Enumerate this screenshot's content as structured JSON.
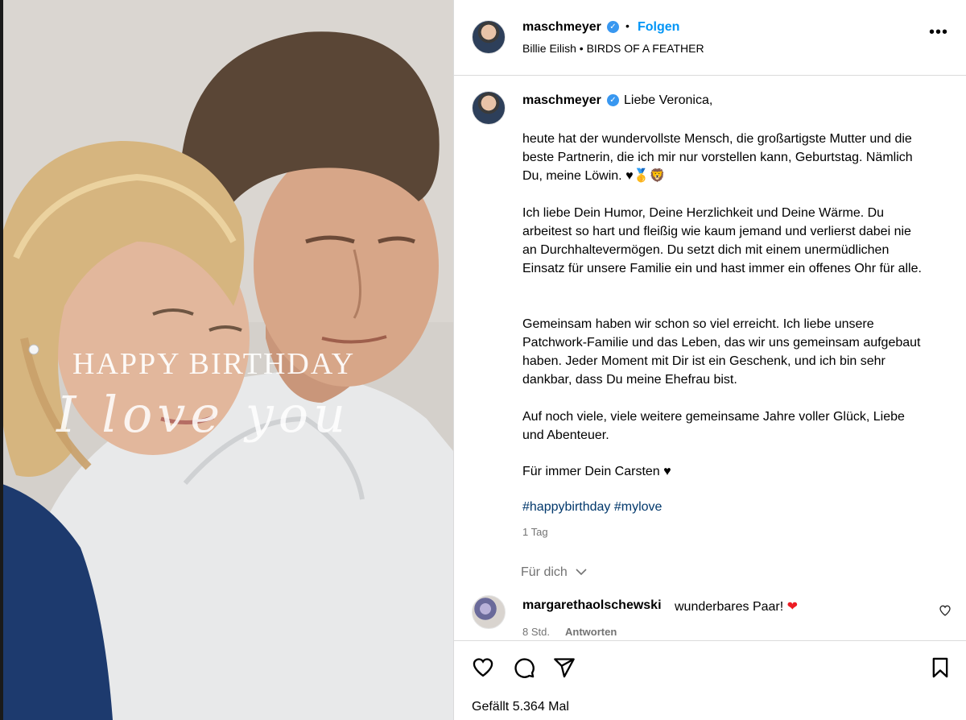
{
  "post": {
    "username": "maschmeyer",
    "follow_label": "Folgen",
    "separator": "•",
    "music": "Billie Eilish • BIRDS OF A FEATHER",
    "more_icon": "more-horizontal-icon"
  },
  "image_overlay": {
    "title": "HAPPY BIRTHDAY",
    "script": "I love you"
  },
  "caption": {
    "username": "maschmeyer",
    "first_line": "Liebe Veronica,",
    "paragraphs": [
      "heute hat der wundervollste Mensch, die großartigste Mutter und die beste Partnerin, die ich mir nur vorstellen kann, Geburtstag. Nämlich Du, meine Löwin. ♥🥇🦁",
      "Ich liebe Dein Humor, Deine Herzlichkeit und Deine Wärme. Du arbeitest so hart und fleißig wie kaum jemand und verlierst dabei nie an Durchhaltevermögen. Du setzt dich mit einem unermüdlichen Einsatz für unsere Familie ein und hast immer ein offenes Ohr für alle.",
      "Gemeinsam haben wir schon so viel erreicht. Ich liebe unsere Patchwork-Familie und das Leben, das wir uns gemeinsam aufgebaut haben. Jeder Moment mit Dir ist ein Geschenk, und ich bin sehr dankbar, dass Du meine Ehefrau bist.",
      "Auf noch viele, viele weitere gemeinsame Jahre voller Glück, Liebe und Abenteuer.",
      "Für immer Dein Carsten ♥"
    ],
    "hashtags": [
      "#happybirthday",
      "#mylove"
    ],
    "time": "1 Tag"
  },
  "for_you_label": "Für dich",
  "comment": {
    "username": "margarethaolschewski",
    "text": "wunderbares Paar!",
    "emoji": "❤",
    "time": "8 Std.",
    "reply_label": "Antworten"
  },
  "actions": {
    "likes_text": "Gefällt 5.364 Mal"
  },
  "colors": {
    "link_blue": "#0095f6",
    "hashtag": "#00376b",
    "muted": "#737373",
    "verified": "#3897f0",
    "border": "#dbdbdb"
  }
}
